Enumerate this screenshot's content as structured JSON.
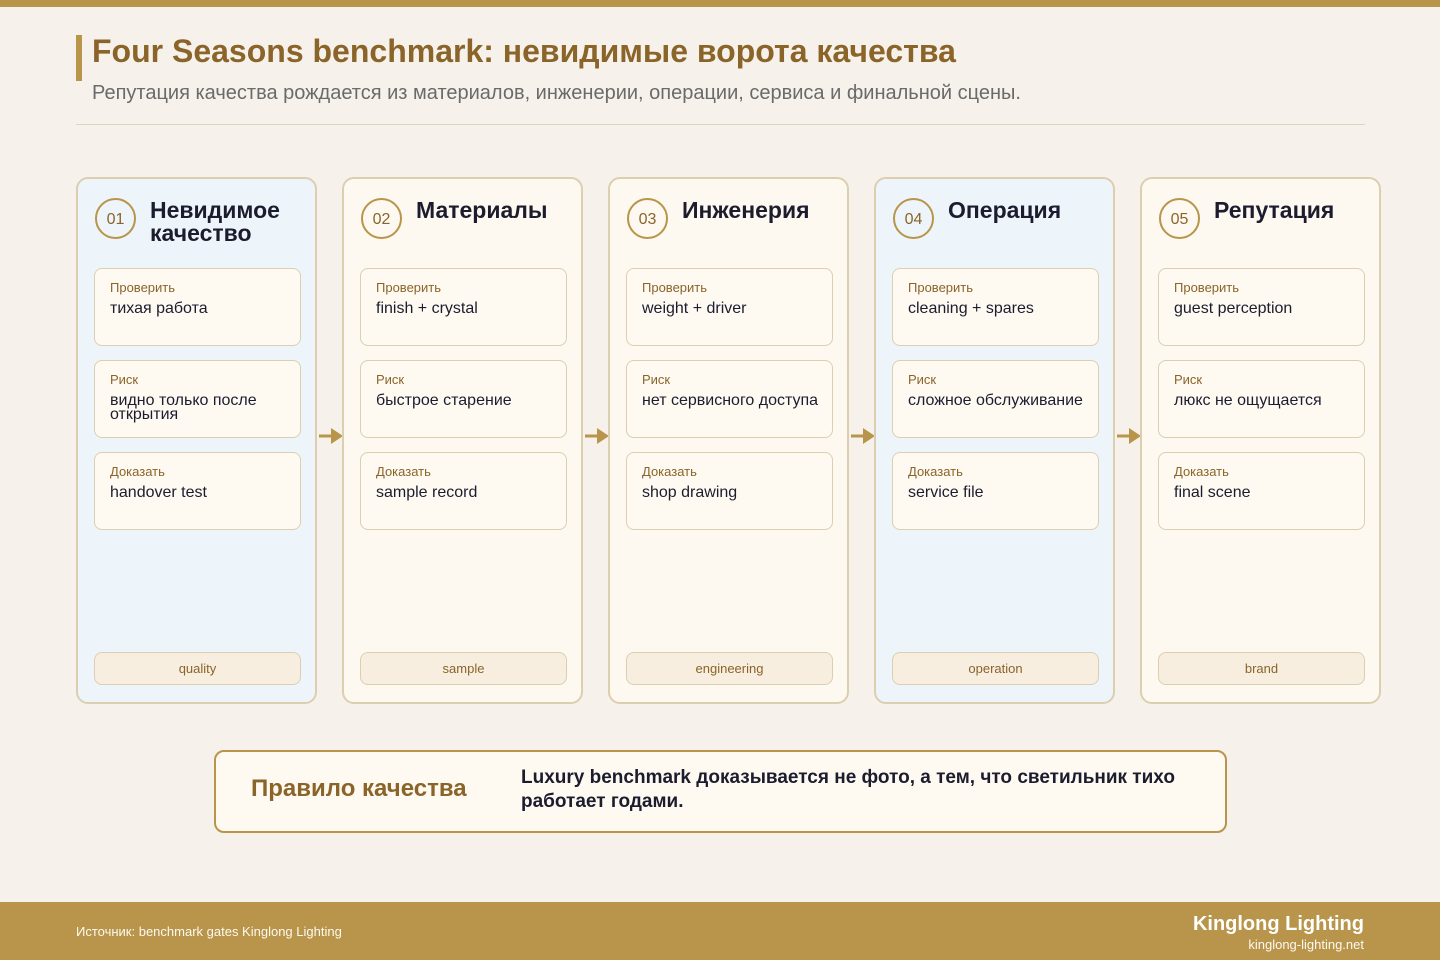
{
  "header": {
    "title": "Four Seasons benchmark: невидимые ворота качества",
    "subtitle": "Репутация качества рождается из материалов, инженерии, операции, сервиса и финальной сцены."
  },
  "gates": [
    {
      "num": "01",
      "title": "Невидимое качество",
      "check_label": "Проверить",
      "check": "тихая работа",
      "risk_label": "Риск",
      "risk": "видно только после открытия",
      "prove_label": "Доказать",
      "prove": "handover test",
      "tag": "quality"
    },
    {
      "num": "02",
      "title": "Материалы",
      "check_label": "Проверить",
      "check": "finish + crystal",
      "risk_label": "Риск",
      "risk": "быстрое старение",
      "prove_label": "Доказать",
      "prove": "sample record",
      "tag": "sample"
    },
    {
      "num": "03",
      "title": "Инженерия",
      "check_label": "Проверить",
      "check": "weight + driver",
      "risk_label": "Риск",
      "risk": "нет сервисного доступа",
      "prove_label": "Доказать",
      "prove": "shop drawing",
      "tag": "engineering"
    },
    {
      "num": "04",
      "title": "Операция",
      "check_label": "Проверить",
      "check": "cleaning + spares",
      "risk_label": "Риск",
      "risk": "сложное обслуживание",
      "prove_label": "Доказать",
      "prove": "service file",
      "tag": "operation"
    },
    {
      "num": "05",
      "title": "Репутация",
      "check_label": "Проверить",
      "check": "guest perception",
      "risk_label": "Риск",
      "risk": "люкс не ощущается",
      "prove_label": "Доказать",
      "prove": "final scene",
      "tag": "brand"
    }
  ],
  "rule": {
    "label": "Правило качества",
    "text": "Luxury benchmark доказывается не фото, а тем, что светильник тихо работает годами."
  },
  "footer": {
    "source": "Источник: benchmark gates Kinglong Lighting",
    "brand": "Kinglong Lighting",
    "url": "kinglong-lighting.net"
  },
  "colors": {
    "accent": "#b8954a",
    "accent_dark": "#8a6428",
    "card_blue": "#edf5fb",
    "card_cream": "#fdf9f0",
    "background": "#f6f2eb"
  },
  "icons": [
    "arrow-right-icon"
  ]
}
